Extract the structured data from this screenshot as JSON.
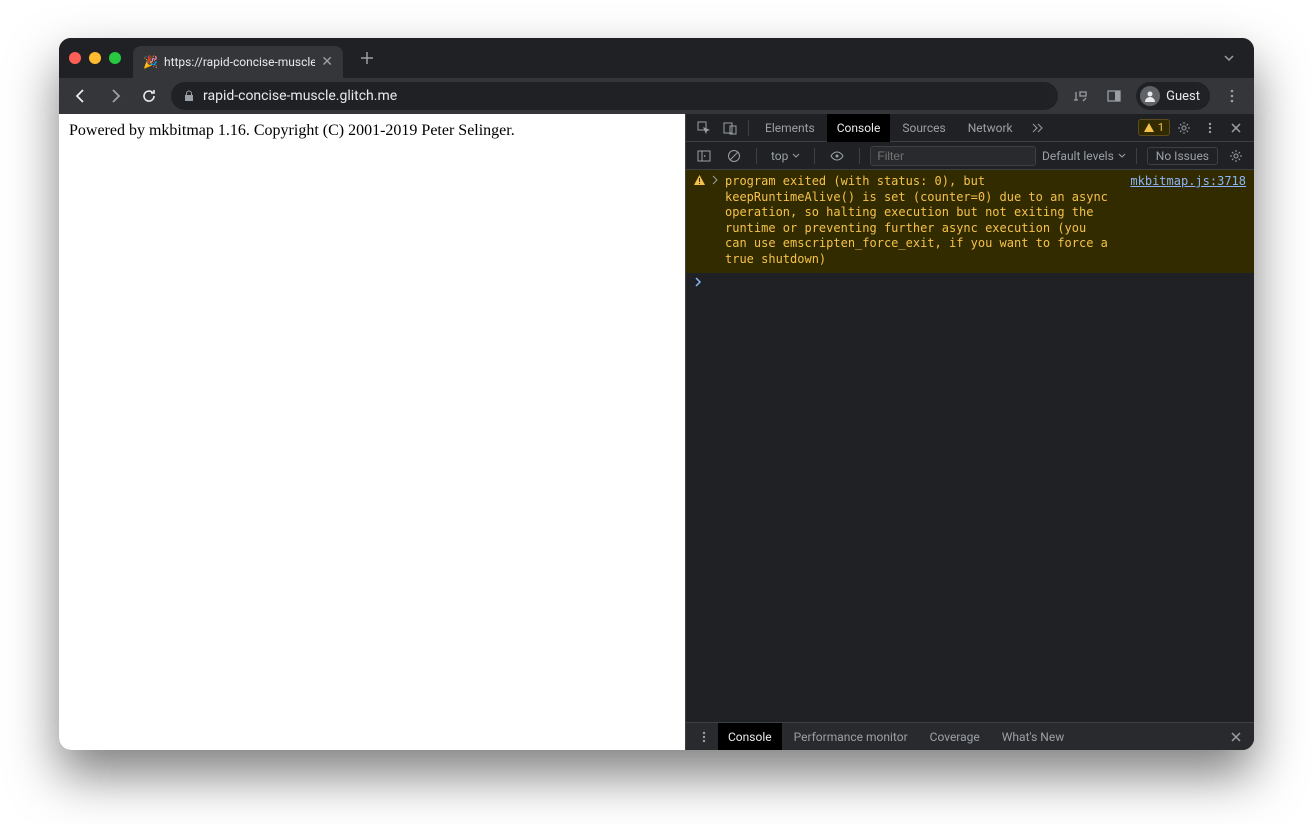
{
  "tab": {
    "title": "https://rapid-concise-muscle.g",
    "favicon": "🎉"
  },
  "address": {
    "url": "rapid-concise-muscle.glitch.me"
  },
  "profile": {
    "label": "Guest"
  },
  "page": {
    "text": "Powered by mkbitmap 1.16. Copyright (C) 2001-2019 Peter Selinger."
  },
  "devtools": {
    "tabs": {
      "elements": "Elements",
      "console": "Console",
      "sources": "Sources",
      "network": "Network"
    },
    "warn_count": "1",
    "toolbar": {
      "context": "top",
      "filter_placeholder": "Filter",
      "levels": "Default levels",
      "issues": "No Issues"
    },
    "message": {
      "text": "program exited (with status: 0), but keepRuntimeAlive() is set (counter=0) due to an async operation, so halting execution but not exiting the runtime or preventing further async execution (you can use emscripten_force_exit, if you want to force a true shutdown)",
      "source": "mkbitmap.js:3718"
    },
    "drawer": {
      "console": "Console",
      "perf": "Performance monitor",
      "coverage": "Coverage",
      "whatsnew": "What's New"
    }
  }
}
